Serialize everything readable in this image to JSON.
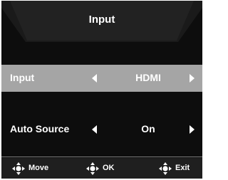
{
  "menu": {
    "title": "Input",
    "items": [
      {
        "label": "Input",
        "value": "HDMI",
        "selected": true
      },
      {
        "label": "Auto Source",
        "value": "On",
        "selected": false
      }
    ]
  },
  "footer": {
    "hints": [
      {
        "icon": "joystick-icon",
        "label": "Move"
      },
      {
        "icon": "joystick-icon",
        "label": "OK"
      },
      {
        "icon": "joystick-icon",
        "label": "Exit"
      }
    ]
  },
  "colors": {
    "background": "#0d0d0d",
    "highlight": "#a5a5a5",
    "text": "#ffffff"
  }
}
